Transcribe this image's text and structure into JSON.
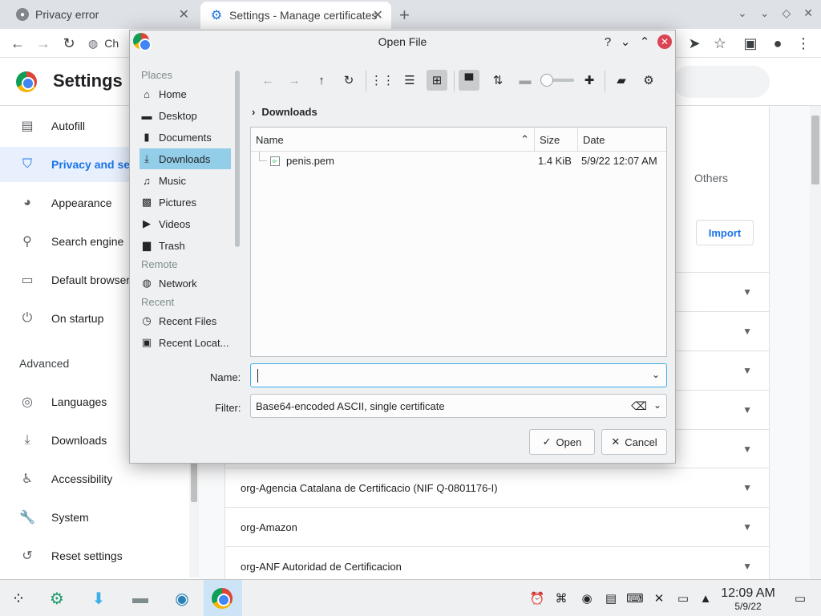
{
  "browser": {
    "tabs": [
      {
        "label": "Privacy error",
        "icon": "globe-icon"
      },
      {
        "label": "Settings - Manage certificates",
        "icon": "gear-icon"
      }
    ],
    "omnibox_text": "Ch"
  },
  "settings": {
    "title": "Settings",
    "nav": [
      {
        "label": "Autofill",
        "icon": "clipboard-icon"
      },
      {
        "label": "Privacy and sec",
        "icon": "shield-icon"
      },
      {
        "label": "Appearance",
        "icon": "palette-icon"
      },
      {
        "label": "Search engine",
        "icon": "search-icon"
      },
      {
        "label": "Default browser",
        "icon": "browser-icon"
      },
      {
        "label": "On startup",
        "icon": "power-icon"
      },
      {
        "label": "Languages",
        "icon": "globe-icon"
      },
      {
        "label": "Downloads",
        "icon": "download-icon"
      },
      {
        "label": "Accessibility",
        "icon": "accessibility-icon"
      },
      {
        "label": "System",
        "icon": "wrench-icon"
      },
      {
        "label": "Reset settings",
        "icon": "history-icon"
      }
    ],
    "advanced_label": "Advanced",
    "others_tab": "Others",
    "import_label": "Import",
    "cert_rows": [
      "org-Agencia Catalana de Certificacio (NIF Q-0801176-I)",
      "org-Amazon",
      "org-ANF Autoridad de Certificacion"
    ]
  },
  "dialog": {
    "title": "Open File",
    "places_heading": "Places",
    "remote_heading": "Remote",
    "recent_heading": "Recent",
    "places": [
      {
        "label": "Home",
        "icon": "home-icon"
      },
      {
        "label": "Desktop",
        "icon": "desktop-icon"
      },
      {
        "label": "Documents",
        "icon": "document-icon"
      },
      {
        "label": "Downloads",
        "icon": "download-icon",
        "selected": true
      },
      {
        "label": "Music",
        "icon": "music-icon"
      },
      {
        "label": "Pictures",
        "icon": "picture-icon"
      },
      {
        "label": "Videos",
        "icon": "video-icon"
      },
      {
        "label": "Trash",
        "icon": "trash-icon"
      }
    ],
    "network_label": "Network",
    "recent_files_label": "Recent Files",
    "recent_locations_label": "Recent Locat...",
    "breadcrumb": "Downloads",
    "columns": {
      "name": "Name",
      "size": "Size",
      "date": "Date"
    },
    "files": [
      {
        "name": "penis.pem",
        "size": "1.4 KiB",
        "date": "5/9/22 12:07 AM"
      }
    ],
    "name_label": "Name:",
    "name_value": "",
    "filter_label": "Filter:",
    "filter_value": "Base64-encoded ASCII, single certificate",
    "open_label": "Open",
    "cancel_label": "Cancel",
    "zoom_fraction": 0.0
  },
  "taskbar": {
    "time": "12:09 AM",
    "date": "5/9/22"
  },
  "colors": {
    "accent": "#1a73e8",
    "selection": "#93cee9",
    "close_button": "#da4453"
  }
}
